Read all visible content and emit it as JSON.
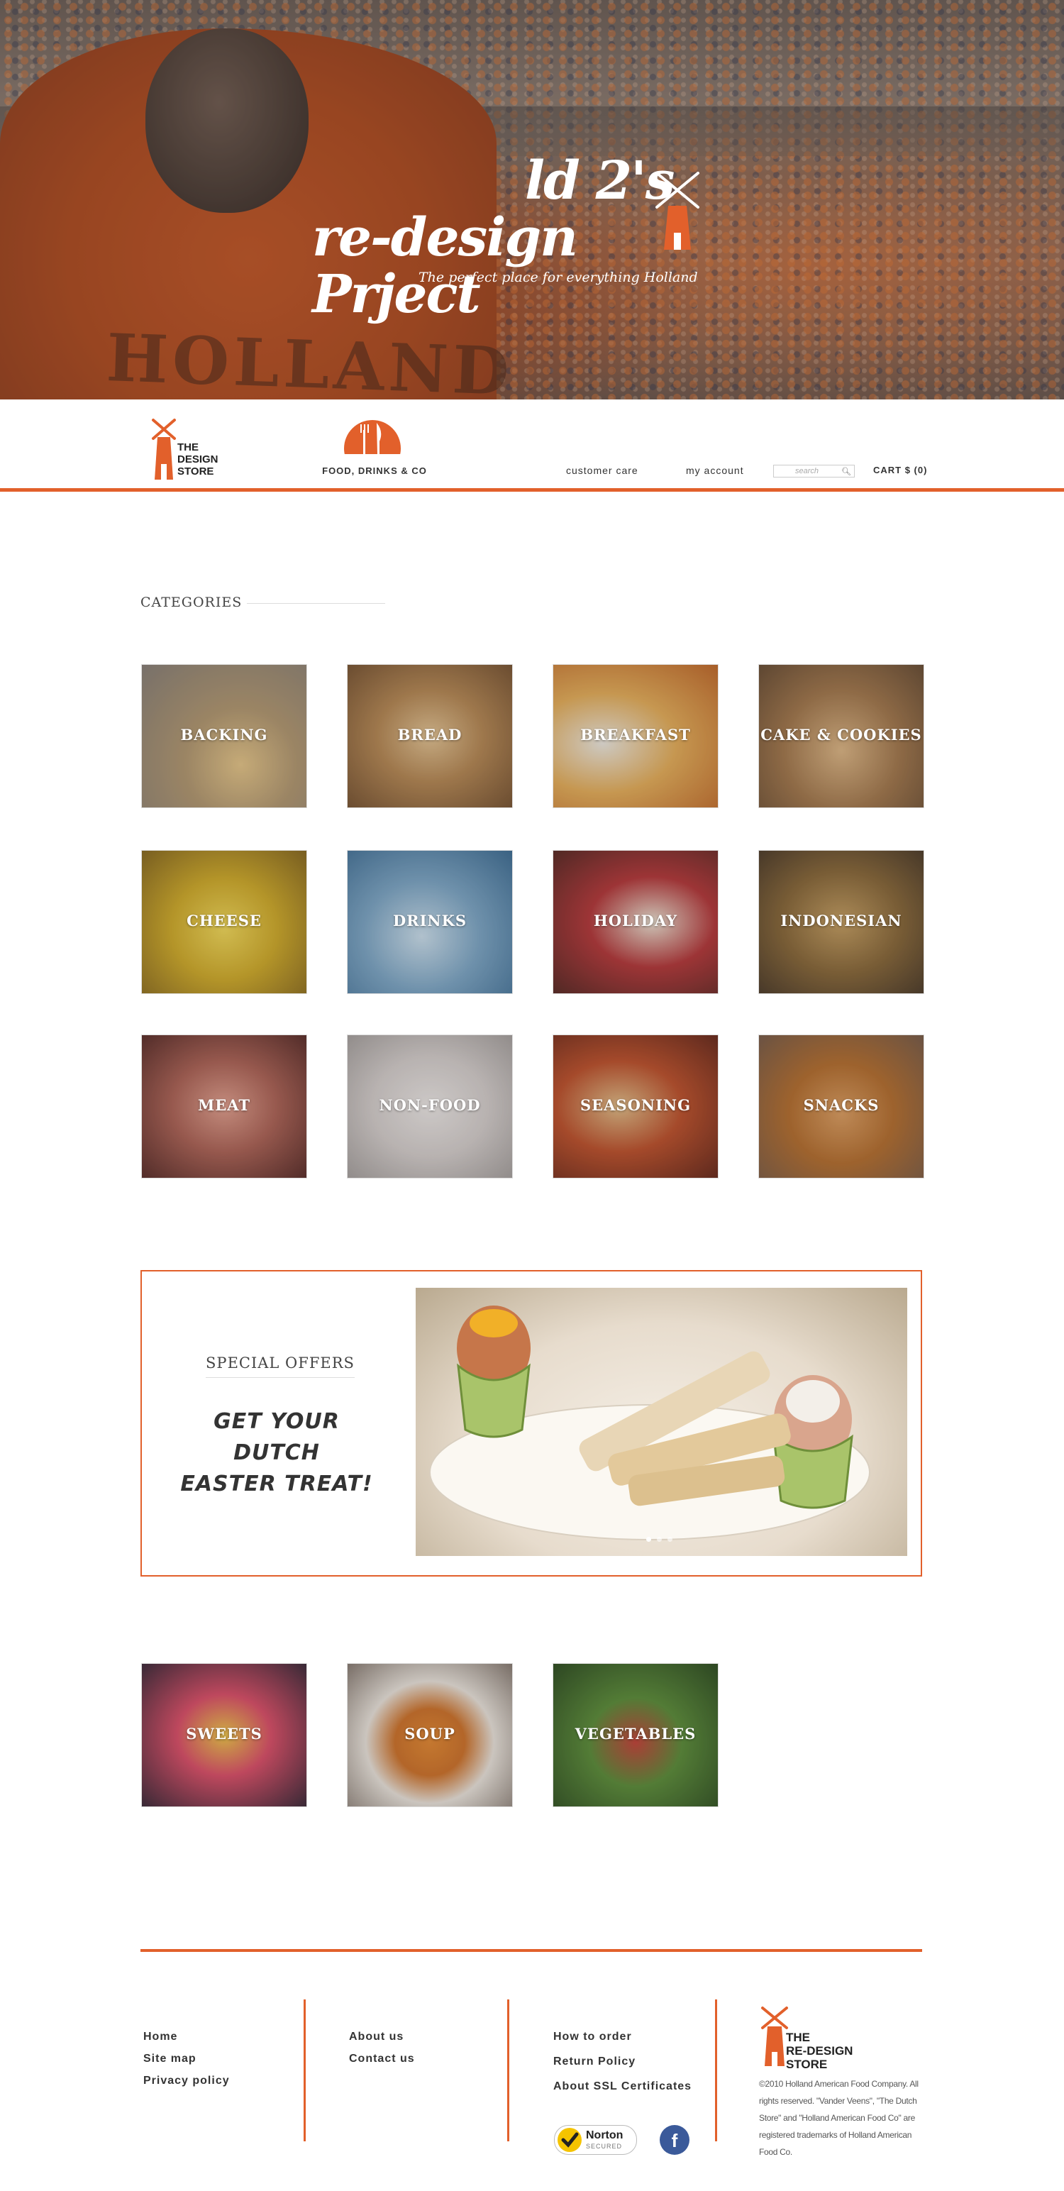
{
  "hero": {
    "title_line1": "ld 2's",
    "title_line2": "re-design Prject",
    "subtitle": "The perfect place for everything Holland",
    "shirt_print": "HOLLAND"
  },
  "header": {
    "logo_line1": "THE",
    "logo_line2": "DESIGN",
    "logo_line3": "STORE",
    "food_label": "FOOD, DRINKS & CO",
    "customer_care": "customer care",
    "my_account": "my account",
    "search_placeholder": "search",
    "cart": "CART $ (0)"
  },
  "categories": {
    "title": "CATEGORIES",
    "items": [
      {
        "label": "BACKING"
      },
      {
        "label": "BREAD"
      },
      {
        "label": "BREAKFAST"
      },
      {
        "label": "CAKE & COOKIES"
      },
      {
        "label": "CHEESE"
      },
      {
        "label": "DRINKS"
      },
      {
        "label": "HOLIDAY"
      },
      {
        "label": "INDONESIAN"
      },
      {
        "label": "MEAT"
      },
      {
        "label": "NON-FOOD"
      },
      {
        "label": "SEASONING"
      },
      {
        "label": "SNACKS"
      }
    ],
    "more_items": [
      {
        "label": "SWEETS"
      },
      {
        "label": "SOUP"
      },
      {
        "label": "VEGETABLES"
      }
    ]
  },
  "offers": {
    "title": "SPECIAL OFFERS",
    "tagline_line1": "GET YOUR DUTCH",
    "tagline_line2": "EASTER TREAT!"
  },
  "footer": {
    "col1": [
      "Home",
      "Site map",
      "Privacy policy"
    ],
    "col2": [
      "About us",
      "Contact us"
    ],
    "col3": [
      "How to order",
      "Return Policy",
      "About SSL Certificates"
    ],
    "logo_line1": "THE",
    "logo_line2": "RE-DESIGN",
    "logo_line3": "STORE",
    "copyright": "©2010 Holland American Food Company. All rights reserved. \"Vander Veens\", \"The Dutch Store\" and \"Holland American Food Co\" are registered trademarks of Holland American Food Co.",
    "norton_label": "Norton",
    "norton_sub": "SECURED",
    "facebook": "f"
  },
  "colors": {
    "accent": "#e2602b"
  }
}
